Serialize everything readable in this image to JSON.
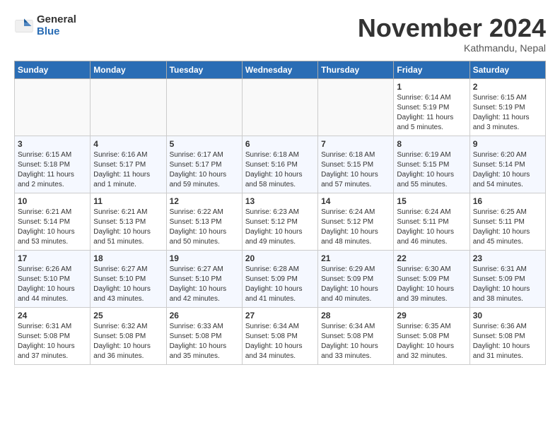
{
  "logo": {
    "general": "General",
    "blue": "Blue"
  },
  "title": "November 2024",
  "subtitle": "Kathmandu, Nepal",
  "weekdays": [
    "Sunday",
    "Monday",
    "Tuesday",
    "Wednesday",
    "Thursday",
    "Friday",
    "Saturday"
  ],
  "weeks": [
    [
      {
        "date": "",
        "info": ""
      },
      {
        "date": "",
        "info": ""
      },
      {
        "date": "",
        "info": ""
      },
      {
        "date": "",
        "info": ""
      },
      {
        "date": "",
        "info": ""
      },
      {
        "date": "1",
        "info": "Sunrise: 6:14 AM\nSunset: 5:19 PM\nDaylight: 11 hours\nand 5 minutes."
      },
      {
        "date": "2",
        "info": "Sunrise: 6:15 AM\nSunset: 5:19 PM\nDaylight: 11 hours\nand 3 minutes."
      }
    ],
    [
      {
        "date": "3",
        "info": "Sunrise: 6:15 AM\nSunset: 5:18 PM\nDaylight: 11 hours\nand 2 minutes."
      },
      {
        "date": "4",
        "info": "Sunrise: 6:16 AM\nSunset: 5:17 PM\nDaylight: 11 hours\nand 1 minute."
      },
      {
        "date": "5",
        "info": "Sunrise: 6:17 AM\nSunset: 5:17 PM\nDaylight: 10 hours\nand 59 minutes."
      },
      {
        "date": "6",
        "info": "Sunrise: 6:18 AM\nSunset: 5:16 PM\nDaylight: 10 hours\nand 58 minutes."
      },
      {
        "date": "7",
        "info": "Sunrise: 6:18 AM\nSunset: 5:15 PM\nDaylight: 10 hours\nand 57 minutes."
      },
      {
        "date": "8",
        "info": "Sunrise: 6:19 AM\nSunset: 5:15 PM\nDaylight: 10 hours\nand 55 minutes."
      },
      {
        "date": "9",
        "info": "Sunrise: 6:20 AM\nSunset: 5:14 PM\nDaylight: 10 hours\nand 54 minutes."
      }
    ],
    [
      {
        "date": "10",
        "info": "Sunrise: 6:21 AM\nSunset: 5:14 PM\nDaylight: 10 hours\nand 53 minutes."
      },
      {
        "date": "11",
        "info": "Sunrise: 6:21 AM\nSunset: 5:13 PM\nDaylight: 10 hours\nand 51 minutes."
      },
      {
        "date": "12",
        "info": "Sunrise: 6:22 AM\nSunset: 5:13 PM\nDaylight: 10 hours\nand 50 minutes."
      },
      {
        "date": "13",
        "info": "Sunrise: 6:23 AM\nSunset: 5:12 PM\nDaylight: 10 hours\nand 49 minutes."
      },
      {
        "date": "14",
        "info": "Sunrise: 6:24 AM\nSunset: 5:12 PM\nDaylight: 10 hours\nand 48 minutes."
      },
      {
        "date": "15",
        "info": "Sunrise: 6:24 AM\nSunset: 5:11 PM\nDaylight: 10 hours\nand 46 minutes."
      },
      {
        "date": "16",
        "info": "Sunrise: 6:25 AM\nSunset: 5:11 PM\nDaylight: 10 hours\nand 45 minutes."
      }
    ],
    [
      {
        "date": "17",
        "info": "Sunrise: 6:26 AM\nSunset: 5:10 PM\nDaylight: 10 hours\nand 44 minutes."
      },
      {
        "date": "18",
        "info": "Sunrise: 6:27 AM\nSunset: 5:10 PM\nDaylight: 10 hours\nand 43 minutes."
      },
      {
        "date": "19",
        "info": "Sunrise: 6:27 AM\nSunset: 5:10 PM\nDaylight: 10 hours\nand 42 minutes."
      },
      {
        "date": "20",
        "info": "Sunrise: 6:28 AM\nSunset: 5:09 PM\nDaylight: 10 hours\nand 41 minutes."
      },
      {
        "date": "21",
        "info": "Sunrise: 6:29 AM\nSunset: 5:09 PM\nDaylight: 10 hours\nand 40 minutes."
      },
      {
        "date": "22",
        "info": "Sunrise: 6:30 AM\nSunset: 5:09 PM\nDaylight: 10 hours\nand 39 minutes."
      },
      {
        "date": "23",
        "info": "Sunrise: 6:31 AM\nSunset: 5:09 PM\nDaylight: 10 hours\nand 38 minutes."
      }
    ],
    [
      {
        "date": "24",
        "info": "Sunrise: 6:31 AM\nSunset: 5:08 PM\nDaylight: 10 hours\nand 37 minutes."
      },
      {
        "date": "25",
        "info": "Sunrise: 6:32 AM\nSunset: 5:08 PM\nDaylight: 10 hours\nand 36 minutes."
      },
      {
        "date": "26",
        "info": "Sunrise: 6:33 AM\nSunset: 5:08 PM\nDaylight: 10 hours\nand 35 minutes."
      },
      {
        "date": "27",
        "info": "Sunrise: 6:34 AM\nSunset: 5:08 PM\nDaylight: 10 hours\nand 34 minutes."
      },
      {
        "date": "28",
        "info": "Sunrise: 6:34 AM\nSunset: 5:08 PM\nDaylight: 10 hours\nand 33 minutes."
      },
      {
        "date": "29",
        "info": "Sunrise: 6:35 AM\nSunset: 5:08 PM\nDaylight: 10 hours\nand 32 minutes."
      },
      {
        "date": "30",
        "info": "Sunrise: 6:36 AM\nSunset: 5:08 PM\nDaylight: 10 hours\nand 31 minutes."
      }
    ]
  ]
}
